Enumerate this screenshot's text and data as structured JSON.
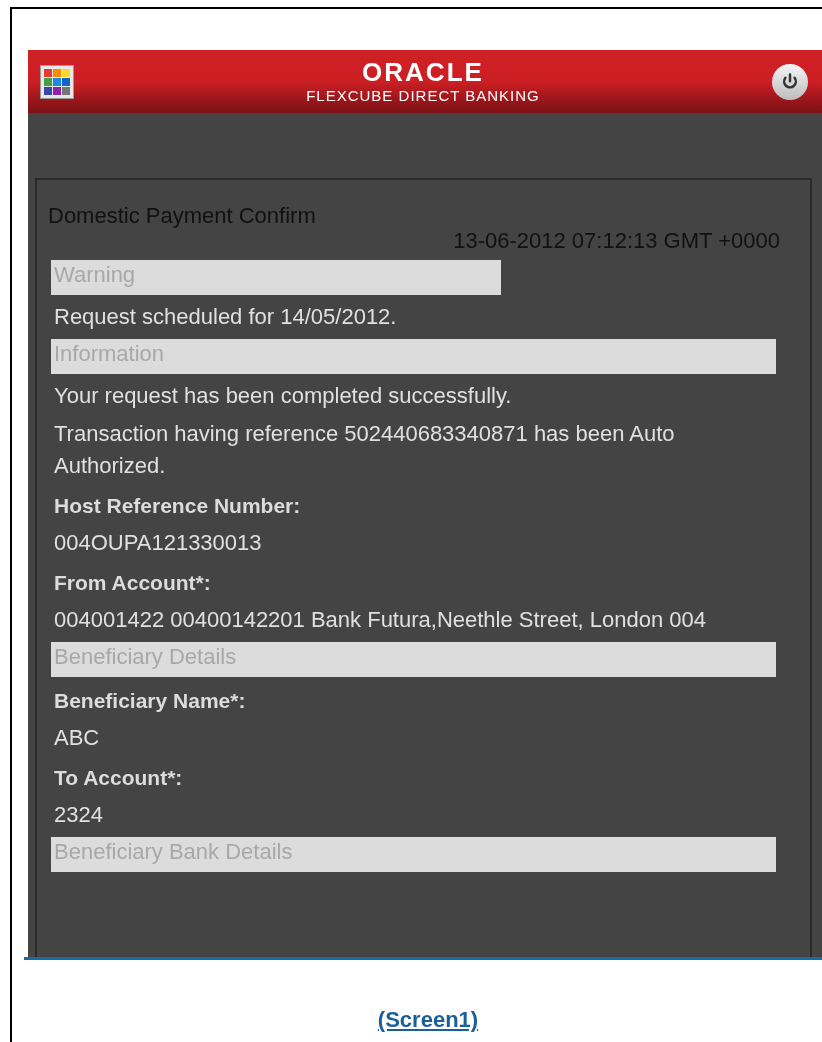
{
  "header": {
    "logo": "ORACLE",
    "subtitle": "FLEXCUBE DIRECT BANKING"
  },
  "content": [
    {
      "kind": "heading",
      "text": "Domestic Payment Confirm"
    },
    {
      "kind": "timestamp",
      "text": "13-06-2012 07:12:13 GMT +0000"
    },
    {
      "kind": "warning",
      "text": "Warning"
    },
    {
      "kind": "message",
      "text": "Request scheduled for 14/05/2012."
    },
    {
      "kind": "section",
      "text": "Information"
    },
    {
      "kind": "message",
      "text": "Your request has been completed successfully."
    },
    {
      "kind": "message",
      "text": "Transaction having reference 502440683340871 has been Auto Authorized."
    },
    {
      "kind": "label",
      "text": "Host Reference Number:"
    },
    {
      "kind": "value",
      "text": "004OUPA121330013"
    },
    {
      "kind": "label",
      "text": "From Account*:"
    },
    {
      "kind": "value",
      "text": "004001422 00400142201 Bank Futura,Neethle Street, London 004"
    },
    {
      "kind": "section",
      "text": "Beneficiary Details"
    },
    {
      "kind": "label",
      "text": "Beneficiary Name*:"
    },
    {
      "kind": "value",
      "text": "ABC"
    },
    {
      "kind": "label",
      "text": "To Account*:"
    },
    {
      "kind": "value",
      "text": "2324"
    },
    {
      "kind": "section",
      "text": "Beneficiary Bank Details"
    }
  ],
  "caption": "(Screen1)"
}
